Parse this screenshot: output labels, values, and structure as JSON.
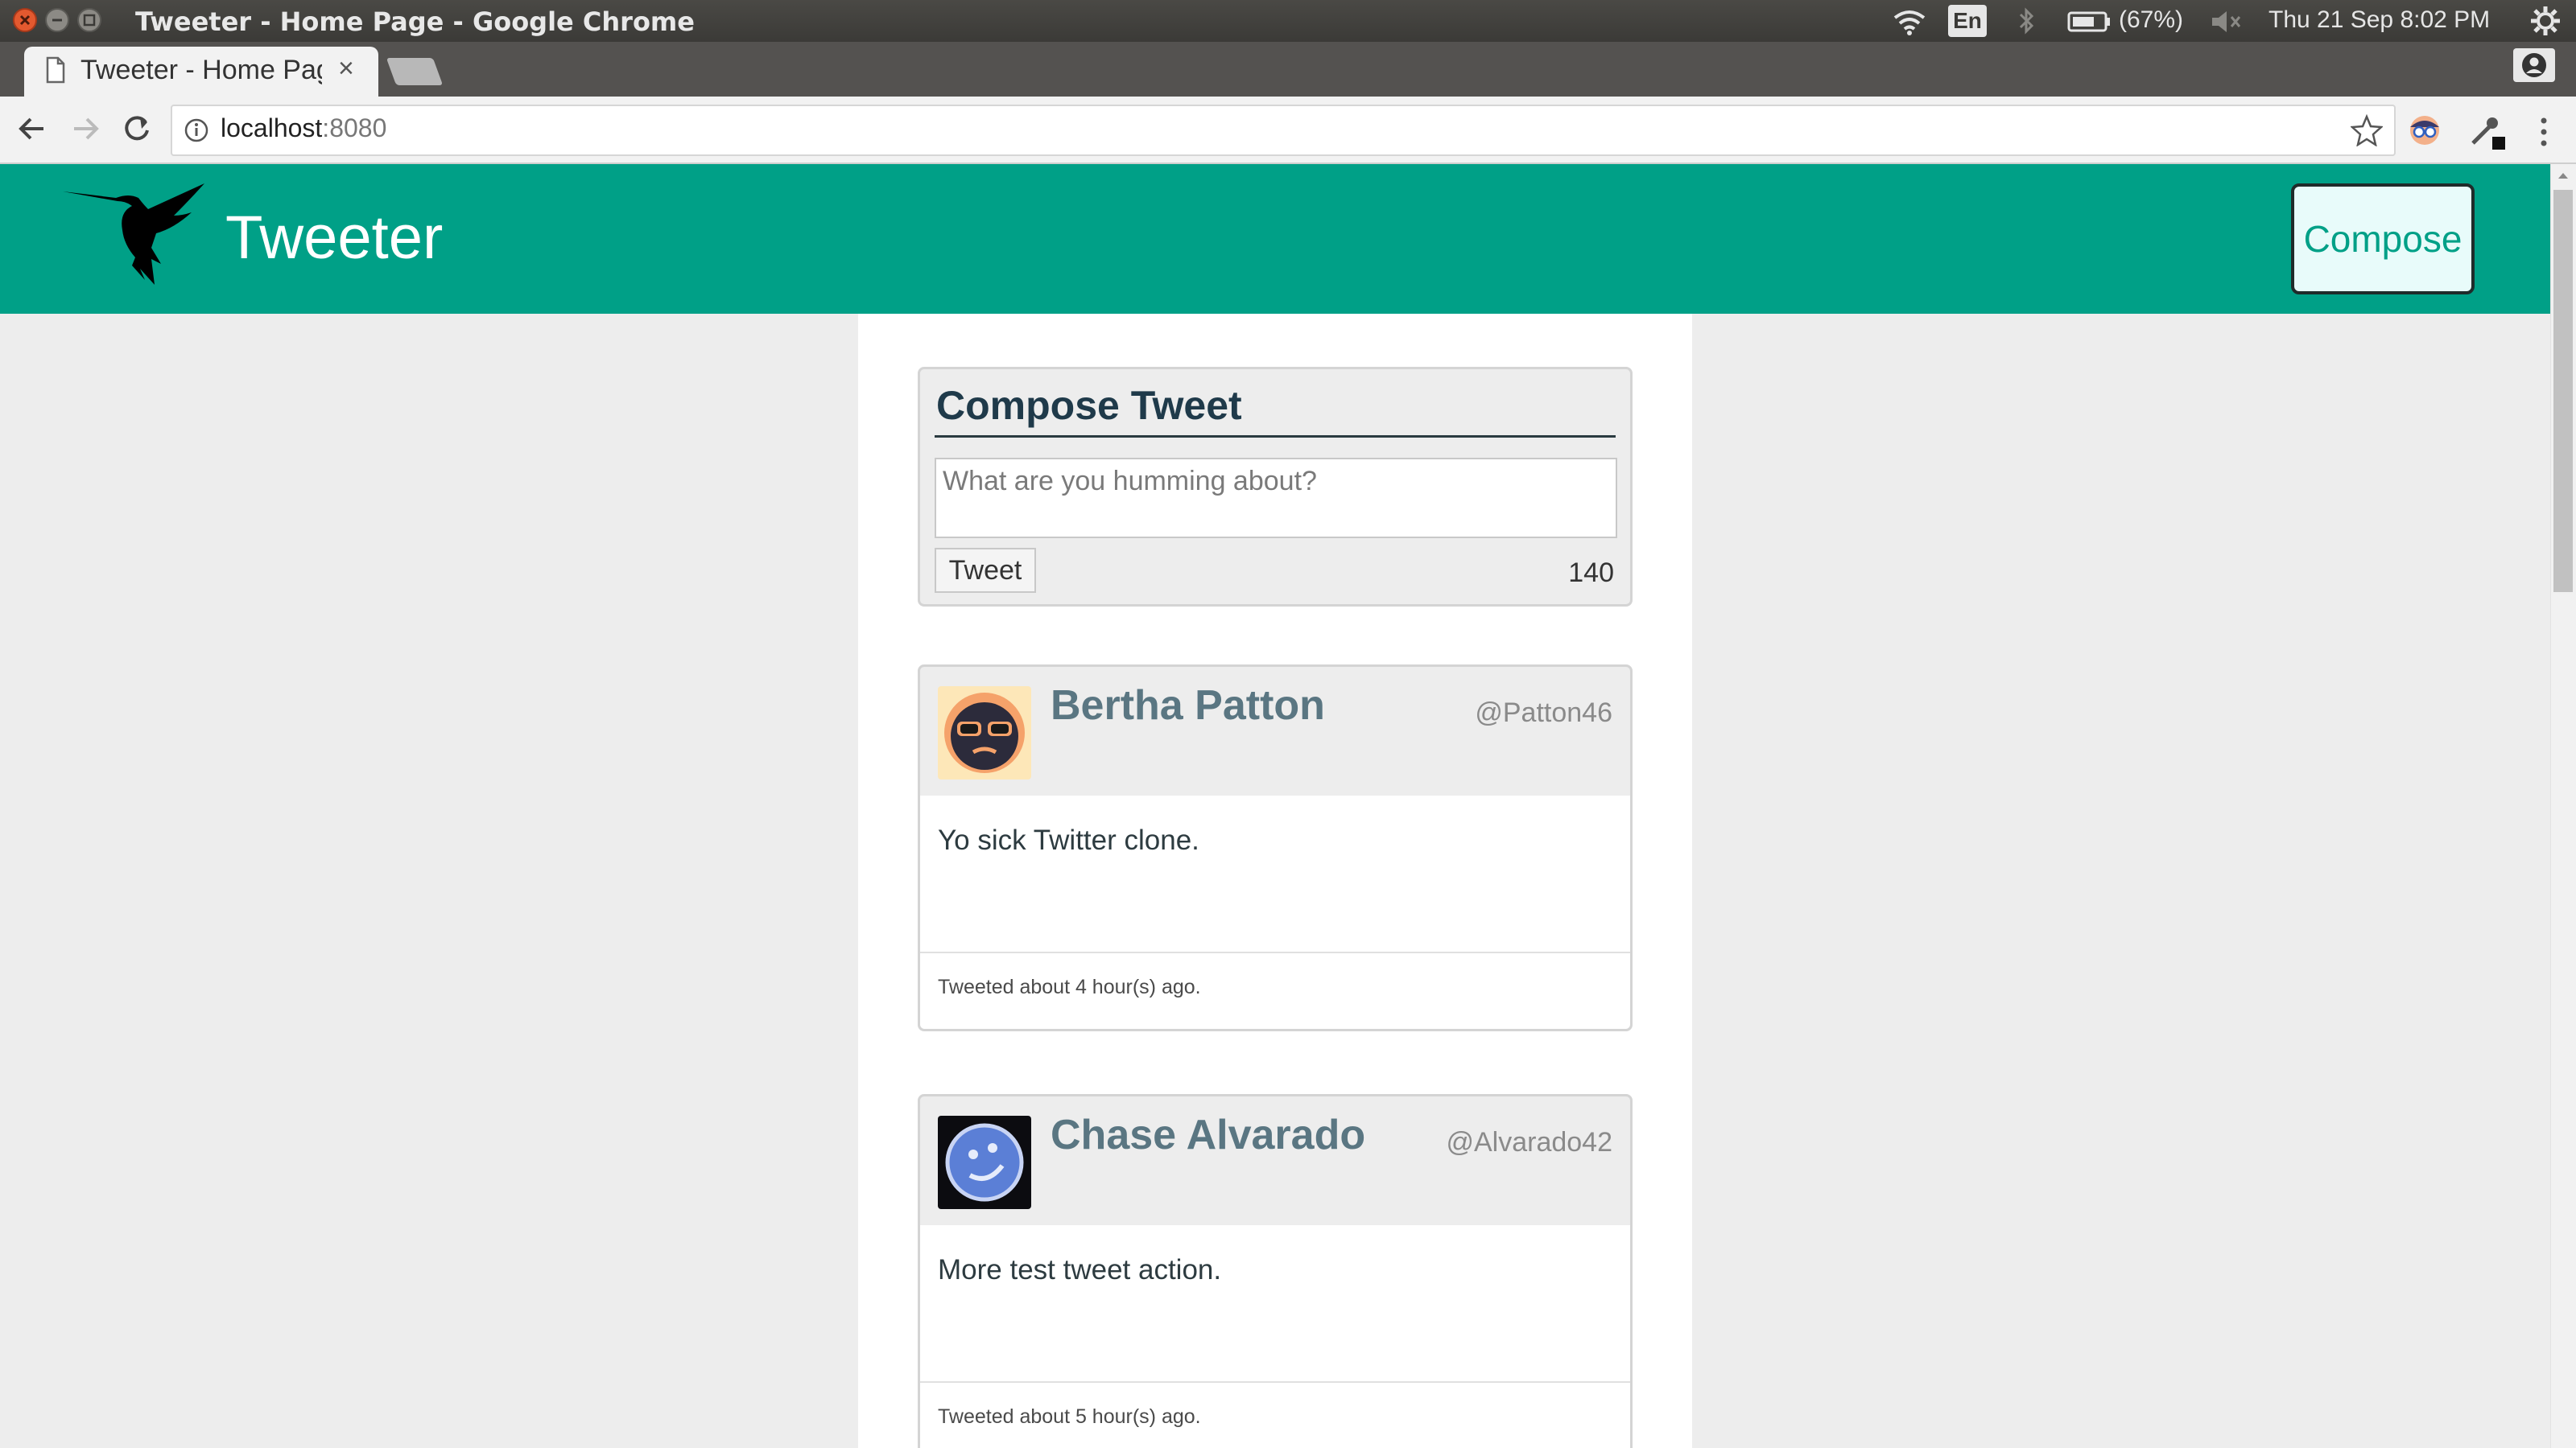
{
  "os_panel": {
    "window_title": "Tweeter - Home Page - Google Chrome",
    "keyboard": "En",
    "battery": "(67%)",
    "datetime": "Thu 21 Sep  8:02 PM"
  },
  "browser": {
    "tab_title": "Tweeter - Home Page",
    "tab_close": "×",
    "url_host": "localhost",
    "url_port": ":8080"
  },
  "header": {
    "brand": "Tweeter",
    "compose_label": "Compose",
    "accent_color": "#00a087"
  },
  "composer": {
    "title": "Compose Tweet",
    "placeholder": "What are you humming about?",
    "submit_label": "Tweet",
    "counter": "140"
  },
  "tweets": [
    {
      "name": "Bertha Patton",
      "handle": "@Patton46",
      "text": "Yo sick Twitter clone.",
      "time": "Tweeted about 4 hour(s) ago.",
      "avatar_icon": "sunglasses-face-icon"
    },
    {
      "name": "Chase Alvarado",
      "handle": "@Alvarado42",
      "text": "More test tweet action.",
      "time": "Tweeted about 5 hour(s) ago.",
      "avatar_icon": "blue-smiley-icon"
    }
  ]
}
